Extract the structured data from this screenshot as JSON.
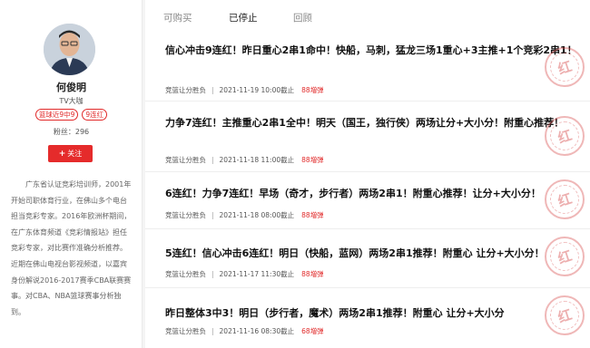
{
  "profile": {
    "name": "何俊明",
    "role": "TV大咖",
    "badges": [
      "篮球近9中9",
      "9连红"
    ],
    "fans_label": "粉丝：",
    "fans_count": "296",
    "follow_label": "关注",
    "bio": "广东省认证竞彩培训师，2001年开始司职体育行业，在佛山多个电台担当竞彩专家。2016年欧洲杯期间，在广东体育频道《竞彩情报站》担任竞彩专家，对比赛作准确分析推荐。近期在佛山电视台影视频道，以嘉宾身份解说2016-2017赛季CBA联赛赛事。对CBA、NBA篮球赛事分析独到。"
  },
  "tabs": [
    {
      "label": "可购买",
      "active": false
    },
    {
      "label": "已停止",
      "active": true
    },
    {
      "label": "回顾",
      "active": false
    }
  ],
  "posts": [
    {
      "title": "信心冲击9连红！昨日重心2串1命中！快船，马刺，猛龙三场1重心+3主推+1个竞彩2串1！",
      "category": "竞篮让分胜负",
      "time": "2021-11-19 10:00截止",
      "count": "88増弹",
      "stamp": "红"
    },
    {
      "title": "力争7连红！主推重心2串1全中！明天（国王，独行侠）两场让分+大小分！附重心推荐！",
      "category": "竞篮让分胜负",
      "time": "2021-11-18 11:00截止",
      "count": "88増弹",
      "stamp": "红"
    },
    {
      "title": "6连红！力争7连红！早场（奇才，步行者）两场2串1！附重心推荐！让分+大小分！",
      "category": "竞篮让分胜负",
      "time": "2021-11-18 08:00截止",
      "count": "88増弹",
      "stamp": "红"
    },
    {
      "title": "5连红！信心冲击6连红！明日（快船，蓝网）两场2串1推荐！附重心 让分+大小分！",
      "category": "竞篮让分胜负",
      "time": "2021-11-17 11:30截止",
      "count": "88増弹",
      "stamp": "红"
    },
    {
      "title": "昨日整体3中3！明日（步行者，魔术）两场2串1推荐！附重心 让分+大小分",
      "category": "竞篮让分胜负",
      "time": "2021-11-16 08:30截止",
      "count": "68増弹",
      "stamp": "红"
    }
  ]
}
